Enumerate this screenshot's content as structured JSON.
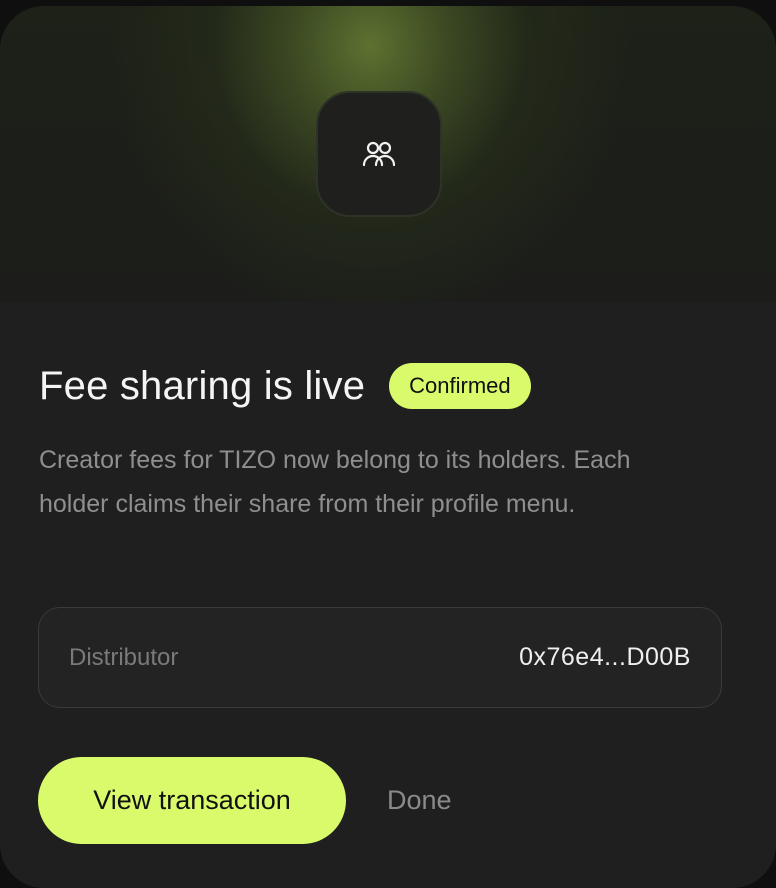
{
  "hero": {
    "icon": "users-group-icon"
  },
  "content": {
    "title": "Fee sharing is live",
    "badge": "Confirmed",
    "description": "Creator fees for TIZO now belong to its holders. Each holder claims their share from their profile menu."
  },
  "distributor": {
    "label": "Distributor",
    "value": "0x76e4...D00B"
  },
  "actions": {
    "primary_label": "View transaction",
    "secondary_label": "Done"
  },
  "colors": {
    "accent": "#d9fb6b",
    "background": "#1f1f1f",
    "muted_text": "#8f8f8f"
  }
}
